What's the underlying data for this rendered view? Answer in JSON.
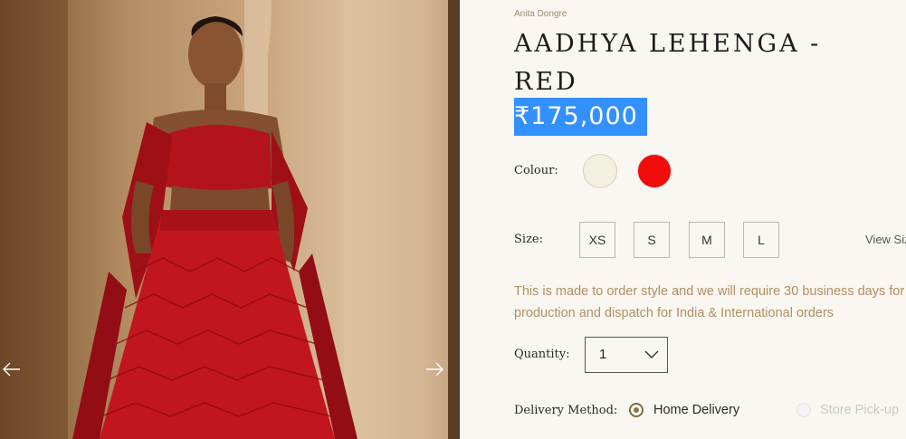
{
  "gallery": {
    "prev_icon": "arrow-left-icon",
    "next_icon": "arrow-right-icon"
  },
  "product": {
    "brand": "Anita Dongre",
    "title": "AADHYA LEHENGA - RED",
    "price": "₹175,000"
  },
  "colour": {
    "label": "Colour:",
    "options": [
      {
        "name": "ivory",
        "hex": "#f2f0df"
      },
      {
        "name": "red",
        "hex": "#f10c0c"
      }
    ]
  },
  "size": {
    "label": "Size:",
    "options": [
      "XS",
      "S",
      "M",
      "L"
    ],
    "guide_link": "View Size Guide"
  },
  "notice": {
    "line1": "This is made to order style and we will require 30 business days for",
    "line2": "production and dispatch for India & International orders"
  },
  "quantity": {
    "label": "Quantity:",
    "value": "1"
  },
  "delivery": {
    "label": "Delivery Method:",
    "options": [
      {
        "label": "Home Delivery",
        "selected": true
      },
      {
        "label": "Store Pick-up",
        "selected": false
      }
    ]
  },
  "colors": {
    "accent": "#b08f62",
    "selection": "#3390ff",
    "background": "#faf7f2"
  }
}
